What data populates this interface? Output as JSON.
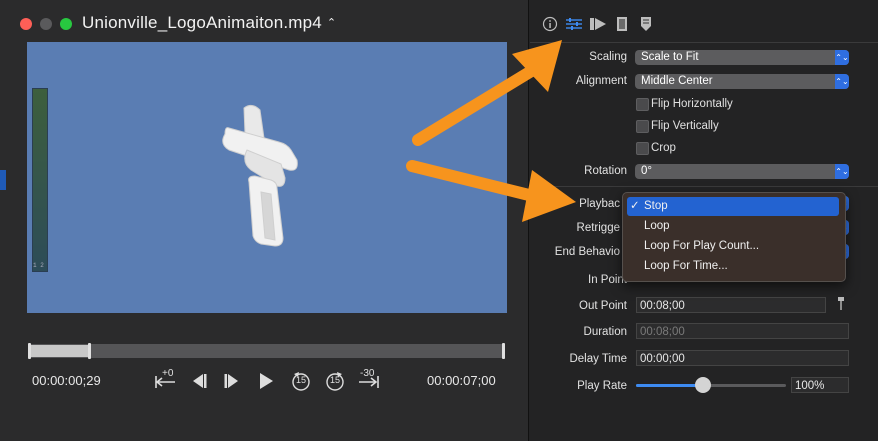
{
  "window": {
    "title": "Unionville_LogoAnimaiton.mp4",
    "title_chevron": "⌃⌄"
  },
  "player": {
    "current_time": "00:00:00;29",
    "duration_time": "00:00:07;00",
    "meter_label": "1 2",
    "controls": {
      "add_marker_label": "+0",
      "skip_back_label": "15",
      "skip_forward_label": "15",
      "jump_back_label": "-30"
    }
  },
  "inspector": {
    "tabs": [
      {
        "name": "info-icon",
        "glyph": "ⓘ"
      },
      {
        "name": "sliders-icon",
        "glyph": "≡"
      },
      {
        "name": "play-flag-icon",
        "glyph": "▶"
      },
      {
        "name": "film-icon",
        "glyph": "▮"
      },
      {
        "name": "bookmark-icon",
        "glyph": "⬇"
      }
    ],
    "scaling": {
      "label": "Scaling",
      "value": "Scale to Fit"
    },
    "alignment": {
      "label": "Alignment",
      "value": "Middle Center"
    },
    "flip_horizontally": {
      "label": "Flip Horizontally",
      "checked": false
    },
    "flip_vertically": {
      "label": "Flip Vertically",
      "checked": false
    },
    "crop": {
      "label": "Crop",
      "checked": false
    },
    "rotation": {
      "label": "Rotation",
      "value": "0°"
    },
    "playback": {
      "label": "Playbac"
    },
    "retrigger": {
      "label": "Retrigge"
    },
    "end_behavior": {
      "label": "End Behavio"
    },
    "in_point": {
      "label": "In Point"
    },
    "out_point": {
      "label": "Out Point",
      "value": "00:08;00"
    },
    "duration": {
      "label": "Duration",
      "value": "00:08;00"
    },
    "delay_time": {
      "label": "Delay Time",
      "value": "00:00;00"
    },
    "play_rate": {
      "label": "Play Rate",
      "value": "100%",
      "slider_fraction": 0.44
    }
  },
  "playback_menu": {
    "items": [
      {
        "label": "Stop",
        "selected": true,
        "check": "✓"
      },
      {
        "label": "Loop",
        "selected": false
      },
      {
        "label": "Loop For Play Count...",
        "selected": false
      },
      {
        "label": "Loop For Time...",
        "selected": false
      }
    ]
  },
  "colors": {
    "accent": "#3d8bf2",
    "annotation_arrow": "#f7941d",
    "video_bg": "#5a7db3",
    "menu_selected": "#2363d1"
  }
}
